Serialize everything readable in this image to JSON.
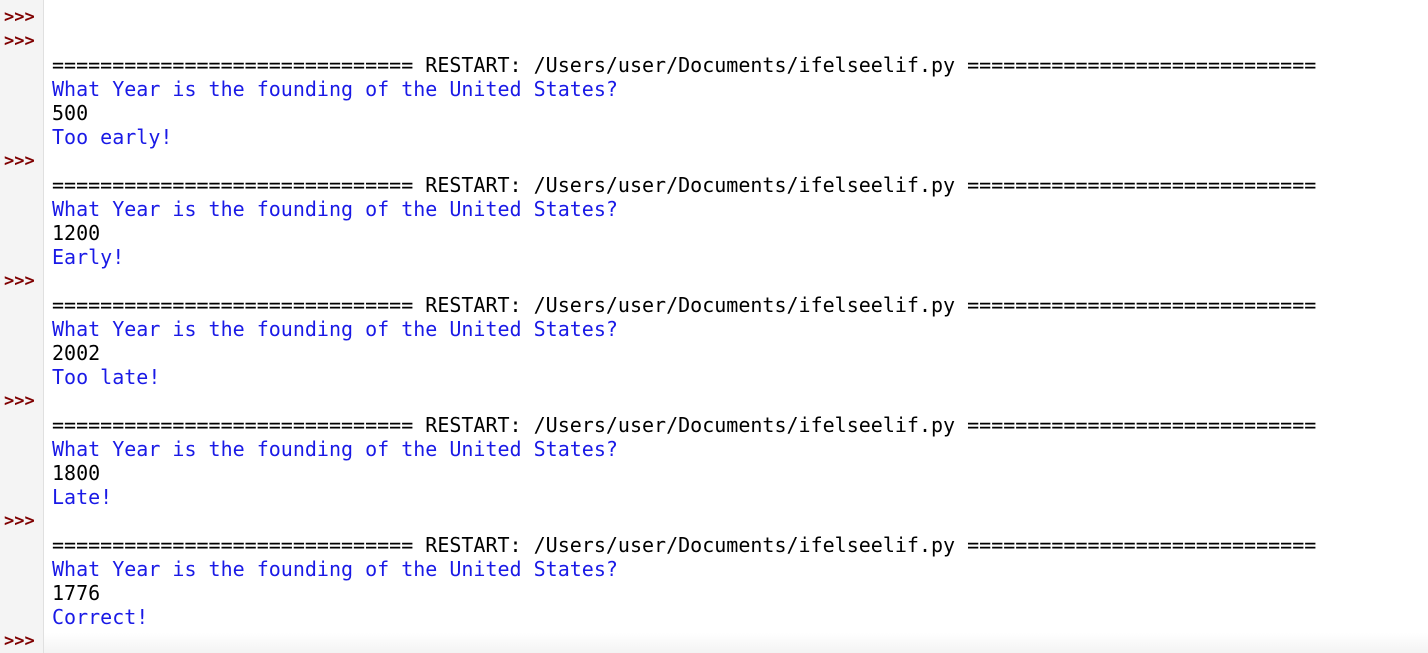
{
  "prompt": ">>>",
  "colors": {
    "prompt": "#7f0000",
    "stdout": "#1a1ae6",
    "stdin": "#000000"
  },
  "lines": [
    {
      "type": "prompt",
      "text": ""
    },
    {
      "type": "prompt",
      "text": ""
    },
    {
      "type": "restart",
      "text": "============================== RESTART: /Users/user/Documents/ifelseelif.py ============================="
    },
    {
      "type": "stdout",
      "text": "What Year is the founding of the United States?"
    },
    {
      "type": "stdin",
      "text": "500"
    },
    {
      "type": "stdout",
      "text": "Too early!"
    },
    {
      "type": "prompt",
      "text": ""
    },
    {
      "type": "restart",
      "text": "============================== RESTART: /Users/user/Documents/ifelseelif.py ============================="
    },
    {
      "type": "stdout",
      "text": "What Year is the founding of the United States?"
    },
    {
      "type": "stdin",
      "text": "1200"
    },
    {
      "type": "stdout",
      "text": "Early!"
    },
    {
      "type": "prompt",
      "text": ""
    },
    {
      "type": "restart",
      "text": "============================== RESTART: /Users/user/Documents/ifelseelif.py ============================="
    },
    {
      "type": "stdout",
      "text": "What Year is the founding of the United States?"
    },
    {
      "type": "stdin",
      "text": "2002"
    },
    {
      "type": "stdout",
      "text": "Too late!"
    },
    {
      "type": "prompt",
      "text": ""
    },
    {
      "type": "restart",
      "text": "============================== RESTART: /Users/user/Documents/ifelseelif.py ============================="
    },
    {
      "type": "stdout",
      "text": "What Year is the founding of the United States?"
    },
    {
      "type": "stdin",
      "text": "1800"
    },
    {
      "type": "stdout",
      "text": "Late!"
    },
    {
      "type": "prompt",
      "text": ""
    },
    {
      "type": "restart",
      "text": "============================== RESTART: /Users/user/Documents/ifelseelif.py ============================="
    },
    {
      "type": "stdout",
      "text": "What Year is the founding of the United States?"
    },
    {
      "type": "stdin",
      "text": "1776"
    },
    {
      "type": "stdout",
      "text": "Correct!"
    },
    {
      "type": "prompt",
      "text": ""
    }
  ]
}
